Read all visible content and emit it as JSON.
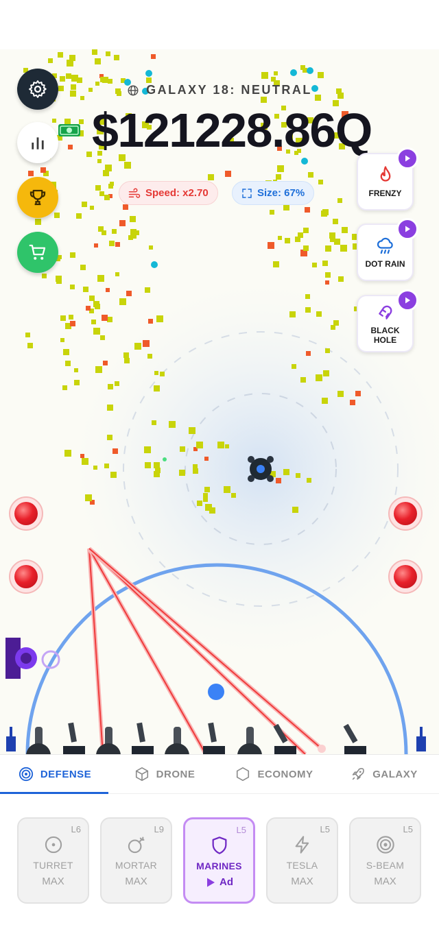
{
  "galaxy": {
    "label": "GALAXY 18: NEUTRAL"
  },
  "money": {
    "value": "$121228.86Q"
  },
  "stats": {
    "speed": "Speed: x2.70",
    "size": "Size: 67%"
  },
  "side_menu": [
    "gear-icon",
    "bar-chart-icon",
    "trophy-icon",
    "cart-icon"
  ],
  "powerups": [
    {
      "label": "FRENZY",
      "icon": "flame-icon",
      "color": "#e53935"
    },
    {
      "label": "DOT RAIN",
      "icon": "cloud-rain-icon",
      "color": "#1e6fd9"
    },
    {
      "label": "BLACK\nHOLE",
      "icon": "magnet-icon",
      "color": "#8b3fe0"
    }
  ],
  "tabs": [
    {
      "label": "DEFENSE",
      "icon": "target-icon",
      "active": true
    },
    {
      "label": "DRONE",
      "icon": "cube-icon",
      "active": false
    },
    {
      "label": "ECONOMY",
      "icon": "hexagon-icon",
      "active": false
    },
    {
      "label": "GALAXY",
      "icon": "rocket-icon",
      "active": false
    }
  ],
  "upgrades": [
    {
      "name": "TURRET",
      "level": "L6",
      "status": "MAX",
      "icon": "turret-icon"
    },
    {
      "name": "MORTAR",
      "level": "L9",
      "status": "MAX",
      "icon": "bomb-icon"
    },
    {
      "name": "MARINES",
      "level": "L5",
      "status": "Ad",
      "icon": "shield-icon",
      "active": true
    },
    {
      "name": "TESLA",
      "level": "L5",
      "status": "MAX",
      "icon": "lightning-icon"
    },
    {
      "name": "S-BEAM",
      "level": "L5",
      "status": "MAX",
      "icon": "beam-icon"
    }
  ],
  "colors": {
    "accent": "#1e63d8",
    "dot": "#c8d40a",
    "laser": "#ef3b3b",
    "shield": "#6fa3ee",
    "ad": "#8b3fe0",
    "money_icon": "#16a34a"
  }
}
